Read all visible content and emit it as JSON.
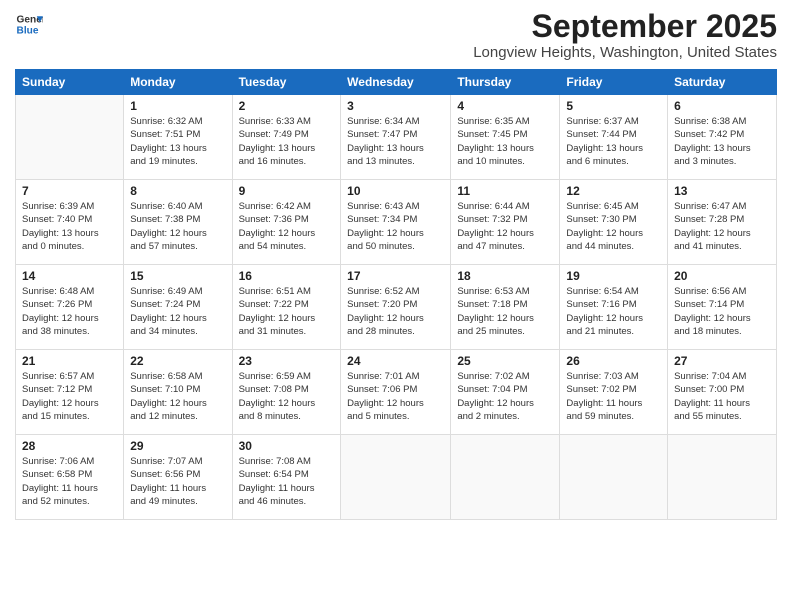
{
  "logo": {
    "line1": "General",
    "line2": "Blue"
  },
  "title": "September 2025",
  "location": "Longview Heights, Washington, United States",
  "weekdays": [
    "Sunday",
    "Monday",
    "Tuesday",
    "Wednesday",
    "Thursday",
    "Friday",
    "Saturday"
  ],
  "weeks": [
    [
      {
        "day": "",
        "info": ""
      },
      {
        "day": "1",
        "info": "Sunrise: 6:32 AM\nSunset: 7:51 PM\nDaylight: 13 hours\nand 19 minutes."
      },
      {
        "day": "2",
        "info": "Sunrise: 6:33 AM\nSunset: 7:49 PM\nDaylight: 13 hours\nand 16 minutes."
      },
      {
        "day": "3",
        "info": "Sunrise: 6:34 AM\nSunset: 7:47 PM\nDaylight: 13 hours\nand 13 minutes."
      },
      {
        "day": "4",
        "info": "Sunrise: 6:35 AM\nSunset: 7:45 PM\nDaylight: 13 hours\nand 10 minutes."
      },
      {
        "day": "5",
        "info": "Sunrise: 6:37 AM\nSunset: 7:44 PM\nDaylight: 13 hours\nand 6 minutes."
      },
      {
        "day": "6",
        "info": "Sunrise: 6:38 AM\nSunset: 7:42 PM\nDaylight: 13 hours\nand 3 minutes."
      }
    ],
    [
      {
        "day": "7",
        "info": "Sunrise: 6:39 AM\nSunset: 7:40 PM\nDaylight: 13 hours\nand 0 minutes."
      },
      {
        "day": "8",
        "info": "Sunrise: 6:40 AM\nSunset: 7:38 PM\nDaylight: 12 hours\nand 57 minutes."
      },
      {
        "day": "9",
        "info": "Sunrise: 6:42 AM\nSunset: 7:36 PM\nDaylight: 12 hours\nand 54 minutes."
      },
      {
        "day": "10",
        "info": "Sunrise: 6:43 AM\nSunset: 7:34 PM\nDaylight: 12 hours\nand 50 minutes."
      },
      {
        "day": "11",
        "info": "Sunrise: 6:44 AM\nSunset: 7:32 PM\nDaylight: 12 hours\nand 47 minutes."
      },
      {
        "day": "12",
        "info": "Sunrise: 6:45 AM\nSunset: 7:30 PM\nDaylight: 12 hours\nand 44 minutes."
      },
      {
        "day": "13",
        "info": "Sunrise: 6:47 AM\nSunset: 7:28 PM\nDaylight: 12 hours\nand 41 minutes."
      }
    ],
    [
      {
        "day": "14",
        "info": "Sunrise: 6:48 AM\nSunset: 7:26 PM\nDaylight: 12 hours\nand 38 minutes."
      },
      {
        "day": "15",
        "info": "Sunrise: 6:49 AM\nSunset: 7:24 PM\nDaylight: 12 hours\nand 34 minutes."
      },
      {
        "day": "16",
        "info": "Sunrise: 6:51 AM\nSunset: 7:22 PM\nDaylight: 12 hours\nand 31 minutes."
      },
      {
        "day": "17",
        "info": "Sunrise: 6:52 AM\nSunset: 7:20 PM\nDaylight: 12 hours\nand 28 minutes."
      },
      {
        "day": "18",
        "info": "Sunrise: 6:53 AM\nSunset: 7:18 PM\nDaylight: 12 hours\nand 25 minutes."
      },
      {
        "day": "19",
        "info": "Sunrise: 6:54 AM\nSunset: 7:16 PM\nDaylight: 12 hours\nand 21 minutes."
      },
      {
        "day": "20",
        "info": "Sunrise: 6:56 AM\nSunset: 7:14 PM\nDaylight: 12 hours\nand 18 minutes."
      }
    ],
    [
      {
        "day": "21",
        "info": "Sunrise: 6:57 AM\nSunset: 7:12 PM\nDaylight: 12 hours\nand 15 minutes."
      },
      {
        "day": "22",
        "info": "Sunrise: 6:58 AM\nSunset: 7:10 PM\nDaylight: 12 hours\nand 12 minutes."
      },
      {
        "day": "23",
        "info": "Sunrise: 6:59 AM\nSunset: 7:08 PM\nDaylight: 12 hours\nand 8 minutes."
      },
      {
        "day": "24",
        "info": "Sunrise: 7:01 AM\nSunset: 7:06 PM\nDaylight: 12 hours\nand 5 minutes."
      },
      {
        "day": "25",
        "info": "Sunrise: 7:02 AM\nSunset: 7:04 PM\nDaylight: 12 hours\nand 2 minutes."
      },
      {
        "day": "26",
        "info": "Sunrise: 7:03 AM\nSunset: 7:02 PM\nDaylight: 11 hours\nand 59 minutes."
      },
      {
        "day": "27",
        "info": "Sunrise: 7:04 AM\nSunset: 7:00 PM\nDaylight: 11 hours\nand 55 minutes."
      }
    ],
    [
      {
        "day": "28",
        "info": "Sunrise: 7:06 AM\nSunset: 6:58 PM\nDaylight: 11 hours\nand 52 minutes."
      },
      {
        "day": "29",
        "info": "Sunrise: 7:07 AM\nSunset: 6:56 PM\nDaylight: 11 hours\nand 49 minutes."
      },
      {
        "day": "30",
        "info": "Sunrise: 7:08 AM\nSunset: 6:54 PM\nDaylight: 11 hours\nand 46 minutes."
      },
      {
        "day": "",
        "info": ""
      },
      {
        "day": "",
        "info": ""
      },
      {
        "day": "",
        "info": ""
      },
      {
        "day": "",
        "info": ""
      }
    ]
  ]
}
